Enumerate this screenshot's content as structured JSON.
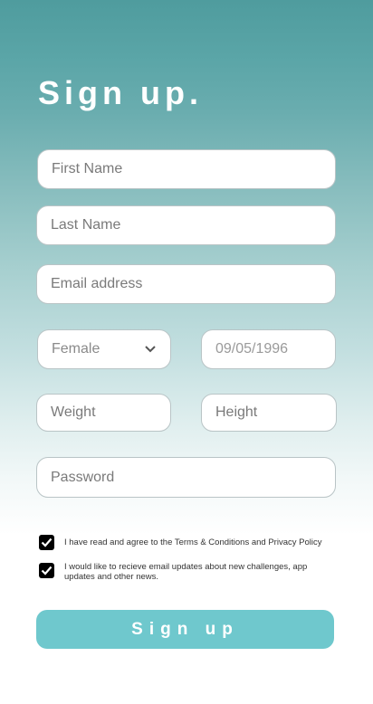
{
  "form": {
    "title": "Sign up.",
    "first_name_placeholder": "First Name",
    "last_name_placeholder": "Last Name",
    "email_placeholder": "Email address",
    "gender_value": "Female",
    "birthdate_value": "09/05/1996",
    "weight_placeholder": "Weight",
    "height_placeholder": "Height",
    "password_placeholder": "Password",
    "terms_label": "I have read and agree to the Terms & Conditions and Privacy Policy",
    "newsletter_label": "I would like to recieve email updates about new challenges, app updates and other news.",
    "terms_checked": true,
    "newsletter_checked": true,
    "submit_label": "Sign up"
  },
  "icons": {
    "gender_dropdown": "chevron-down-icon",
    "checkbox_check": "check-icon"
  },
  "colors": {
    "button": "#6fc8cd",
    "header_top": "#4f9c9e"
  }
}
